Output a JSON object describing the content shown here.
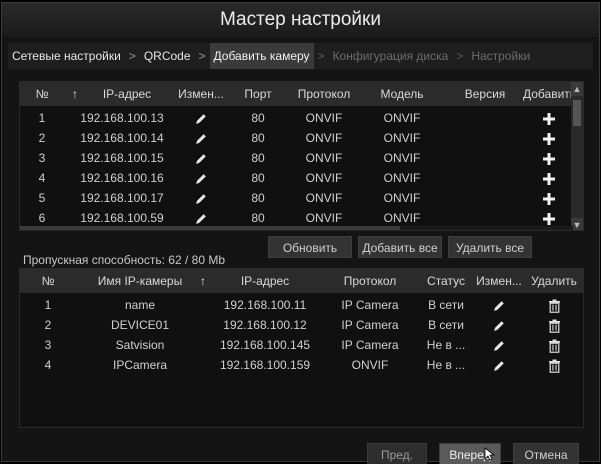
{
  "window": {
    "title": "Мастер настройки"
  },
  "steps": [
    {
      "label": "Сетевые настройки",
      "state": "done"
    },
    {
      "label": "QRCode",
      "state": "done"
    },
    {
      "label": "Добавить камеру",
      "state": "active"
    },
    {
      "label": "Конфигурация диска",
      "state": "future"
    },
    {
      "label": "Настройки",
      "state": "future"
    }
  ],
  "step_separator": ">",
  "search_table": {
    "columns": [
      "№",
      "IP-адрес",
      "Измен...",
      "Порт",
      "Протокол",
      "Модель",
      "Версия",
      "Добавить"
    ],
    "sort_arrow": "↑",
    "rows": [
      {
        "no": "1",
        "ip": "192.168.100.13",
        "port": "80",
        "protocol": "ONVIF",
        "model": "ONVIF",
        "version": ""
      },
      {
        "no": "2",
        "ip": "192.168.100.14",
        "port": "80",
        "protocol": "ONVIF",
        "model": "ONVIF",
        "version": ""
      },
      {
        "no": "3",
        "ip": "192.168.100.15",
        "port": "80",
        "protocol": "ONVIF",
        "model": "ONVIF",
        "version": ""
      },
      {
        "no": "4",
        "ip": "192.168.100.16",
        "port": "80",
        "protocol": "ONVIF",
        "model": "ONVIF",
        "version": ""
      },
      {
        "no": "5",
        "ip": "192.168.100.17",
        "port": "80",
        "protocol": "ONVIF",
        "model": "ONVIF",
        "version": ""
      },
      {
        "no": "6",
        "ip": "192.168.100.59",
        "port": "80",
        "protocol": "ONVIF",
        "model": "ONVIF",
        "version": ""
      }
    ]
  },
  "bandwidth": {
    "label": "Пропускная способность: 62 / 80 Mb"
  },
  "actions": {
    "refresh": "Обновить",
    "add_all": "Добавить все",
    "delete_all": "Удалить все"
  },
  "added_table": {
    "columns": [
      "№",
      "Имя IP-камеры",
      "IP-адрес",
      "Протокол",
      "Статус",
      "Измен...",
      "Удалить"
    ],
    "sort_arrow": "↑",
    "rows": [
      {
        "no": "1",
        "name": "name",
        "ip": "192.168.100.11",
        "protocol": "IP Camera",
        "status": "В сети"
      },
      {
        "no": "2",
        "name": "DEVICE01",
        "ip": "192.168.100.12",
        "protocol": "IP Camera",
        "status": "В сети"
      },
      {
        "no": "3",
        "name": "Satvision",
        "ip": "192.168.100.145",
        "protocol": "IP Camera",
        "status": "Не в ..."
      },
      {
        "no": "4",
        "name": "IPCamera",
        "ip": "192.168.100.159",
        "protocol": "ONVIF",
        "status": "Не в ..."
      }
    ]
  },
  "footer": {
    "prev": "Пред.",
    "next": "Вперед",
    "cancel": "Отмена"
  },
  "colors": {
    "background": "#141414",
    "header": "#2b2b2b",
    "active_step": "#3a3a3a",
    "text": "#cfcfcf",
    "disabled_text": "#6c6c6c"
  }
}
